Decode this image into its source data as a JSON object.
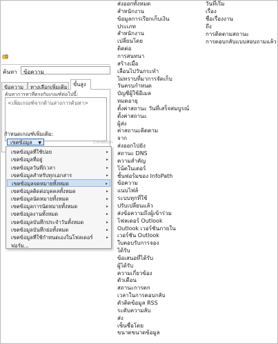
{
  "dialog": {
    "search_label": "ค้นหา",
    "search_value": "ข้อความ",
    "tabs": [
      "ข้อความ",
      "ทางเลือกเพิ่มเติม",
      "ขั้นสูง"
    ],
    "active_tab": 2,
    "criteria_label": "ค้นหาการหาที่ตรงกับเกณฑ์ต่อไปนี้:",
    "criteria_placeholder": "<เพิ่มเกณฑ์จากด้านล่างการค้นหา>",
    "add_criteria_label": "กำหนดเกณฑ์เพิ่มเติม:",
    "field_button": "เขตข้อมูล",
    "condition_label": "Condition",
    "dropdown_items": [
      "เขตข้อมูลที่ใช้บ่อย",
      "เขตข้อมูลที่อยู่",
      "เขตข้อมูลวันที่/เวลา",
      "เขตข้อมูลสำหรับทุกเอกสาร",
      "เขตข้อมูลจดหมายทั้งหมด",
      "เขตข้อมูลติดต่อบุคคลทั้งหมด",
      "เขตข้อมูลนัดหมายทั้งหมด",
      "เขตข้อมูลการนัดหมายทั้งหมด",
      "เขตข้อมูลงานทั้งหมด",
      "เขตข้อมูลบันทึกประจำวันทั้งหมด",
      "เขตข้อมูลบันทึกย่อทั้งหมด",
      "เขตข้อมูลที่ใช้กำหนดเองในโฟลเดอร์",
      "ฟอร์ม..."
    ],
    "highlighted_index": 4
  },
  "column1": [
    "ส่งออกทั้งหมด",
    "สำหนักงาน",
    "ข้อมูลการเรียกเก็บเงิน",
    "ประเภท",
    "สำหนักงาน",
    "เปลี่ยนโดย",
    "ติดต่อ",
    "การสนทนา",
    "สร้างเมื่อ",
    "เลื่อนไปวันกระทำ",
    "ไม่ทราบที่มาการจัดเก็บ",
    "วันครบกำหนด",
    "บัญชีผู้ใช้อีเมล",
    "หมดอายุ",
    "ตั้งค่าสถานะ วันที่เสร็จสมบูรณ์",
    "ตั้งค่าสถานะ",
    "ผู้ส่ง",
    "ค่าสถานะติดตาม",
    "จาก",
    "ส่งออกไปยัง",
    "สถานะ DNS",
    "ความสำคัญ",
    "โน้ตในเดอร์",
    "ชั้นฟอร์มของ InfoPath",
    "ข้อความ",
    "แนบไฟล์",
    "ระบบทุกที่ใช้",
    "ปรับเปลี่ยนแล้ว",
    "ส่งข้อความถึงผู้เข้าร่วม",
    "โฟลเดอร์ Outlook",
    "Outlook เวอร์ชันภายใน",
    "เวอร์ชัน Outlook",
    "ใบตอบรับการจอง",
    "ได้รับ",
    "ข้อเสนอที่ได้รับ",
    "ผู้ได้รับ",
    "ความเกี่ยวข้อง",
    "ตัวเตือน",
    "สถานะการตก",
    "เวลาในการตอบกลับ",
    "ตัวติดข้อมูล RSS",
    "ระดับความลับ",
    "ส่ง",
    "เซ็นชื่อโดย",
    "ขนาดขนาดข้อมูล"
  ],
  "column2": [
    "วันที่เริ่ม",
    "เรื่อง",
    "ชื่อเรื่องงาน",
    "ถึง",
    "การติดตามสถานะ",
    "การตอบกลับแบบสอบถามแล้ว"
  ]
}
